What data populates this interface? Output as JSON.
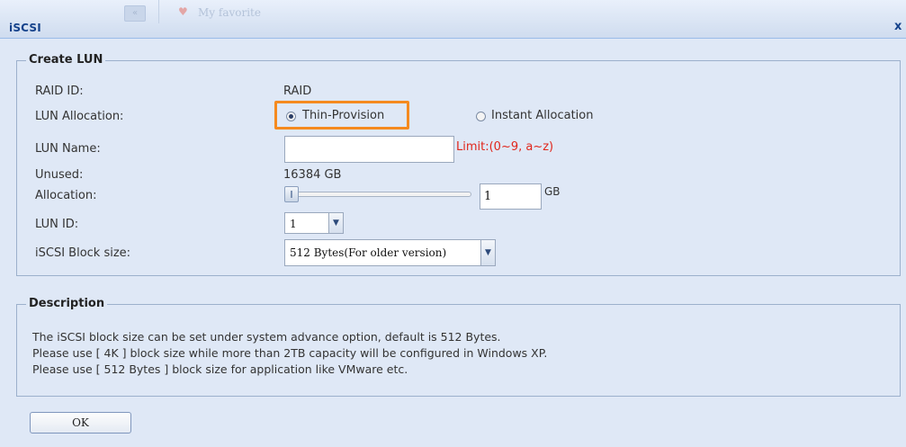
{
  "window": {
    "title": "iSCSI",
    "close_glyph": "x",
    "ghost_tab_label": "My favorite",
    "ghost_btn_glyph": "«"
  },
  "create_lun": {
    "legend": "Create LUN",
    "raid_id": {
      "label": "RAID ID:",
      "value": "RAID"
    },
    "lun_allocation": {
      "label": "LUN Allocation:",
      "options": [
        {
          "label": "Thin-Provision",
          "selected": true
        },
        {
          "label": "Instant Allocation",
          "selected": false
        }
      ]
    },
    "lun_name": {
      "label": "LUN Name:",
      "value": "",
      "limit_text": "Limit:(0~9, a~z)"
    },
    "unused": {
      "label": "Unused:",
      "value": "16384 GB"
    },
    "allocation": {
      "label": "Allocation:",
      "value": "1",
      "unit": "GB",
      "slider_fraction": 0.0
    },
    "lun_id": {
      "label": "LUN ID:",
      "value": "1"
    },
    "block_size": {
      "label": "iSCSI Block size:",
      "value": "512 Bytes(For older version)"
    }
  },
  "description": {
    "legend": "Description",
    "lines": [
      "The iSCSI block size can be set under system advance option, default is 512 Bytes.",
      "Please use [ 4K ] block size while more than 2TB capacity will be configured in Windows XP.",
      "Please use [ 512 Bytes ] block size for application like VMware etc."
    ]
  },
  "ok_button": "OK",
  "colors": {
    "highlight": "#f58a1f",
    "limit": "#e0261b",
    "background": "#dfe8f6"
  },
  "icons": {
    "dropdown": "chevron-down-icon",
    "close": "close-icon",
    "favorite": "heart-icon"
  }
}
